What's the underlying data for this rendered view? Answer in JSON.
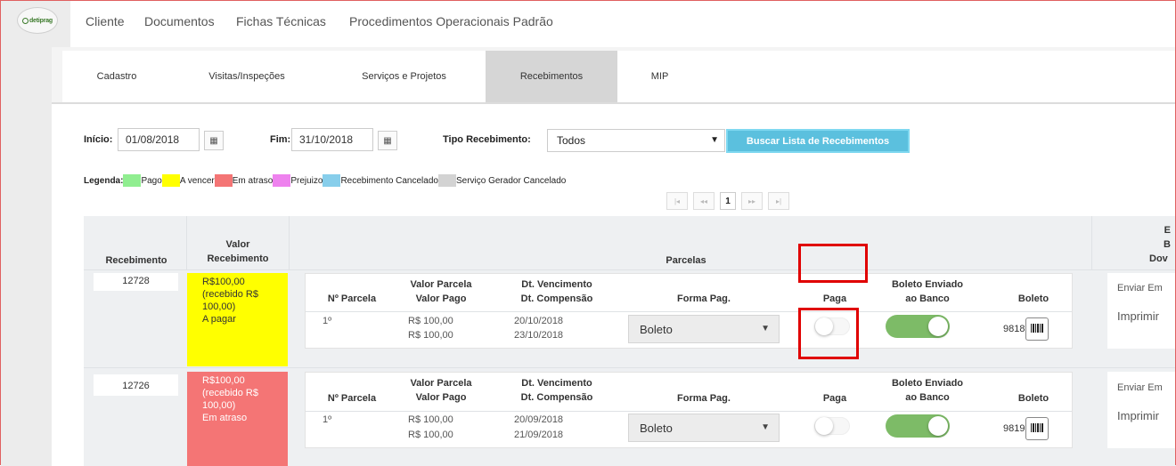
{
  "logo": {
    "text": "detiprag"
  },
  "topnav": {
    "items": [
      "Cliente",
      "Documentos",
      "Fichas Técnicas",
      "Procedimentos Operacionais Padrão"
    ]
  },
  "tabs": [
    {
      "label": "Cadastro",
      "active": false
    },
    {
      "label": "Visitas/Inspeções",
      "active": false
    },
    {
      "label": "Serviços e Projetos",
      "active": false
    },
    {
      "label": "Recebimentos",
      "active": true
    },
    {
      "label": "MIP",
      "active": false
    }
  ],
  "filters": {
    "inicio_label": "Início:",
    "inicio_value": "01/08/2018",
    "fim_label": "Fim:",
    "fim_value": "31/10/2018",
    "tipo_label": "Tipo Recebimento:",
    "tipo_value": "Todos",
    "buscar_label": "Buscar Lista de Recebimentos"
  },
  "legend": {
    "title": "Legenda:",
    "items": [
      {
        "label": "Pago",
        "color": "#90ee90"
      },
      {
        "label": "A vencer",
        "color": "#ffff00"
      },
      {
        "label": "Em atraso",
        "color": "#f47575"
      },
      {
        "label": "Prejuizo",
        "color": "#ee82ee"
      },
      {
        "label": "Recebimento Cancelado",
        "color": "#87ceeb"
      },
      {
        "label": "Serviço Gerador Cancelado",
        "color": "#d3d3d3"
      }
    ]
  },
  "pager": {
    "first": "|◂",
    "prev": "◂◂",
    "current": "1",
    "next": "▸▸",
    "last": "▸|"
  },
  "table": {
    "headers": {
      "recebimento": "Recebimento",
      "valor_line1": "Valor",
      "valor_line2": "Recebimento",
      "parcelas": "Parcelas",
      "extra_line1": "E",
      "extra_line2": "B",
      "extra_line3": "Dov"
    },
    "inner_headers": {
      "parcela": "Nº Parcela",
      "valor_line1": "Valor Parcela",
      "valor_line2": "Valor Pago",
      "dt_line1": "Dt. Vencimento",
      "dt_line2": "Dt. Compensão",
      "forma": "Forma Pag.",
      "paga": "Paga",
      "enviado_line1": "Boleto Enviado",
      "enviado_line2": "ao Banco",
      "boleto": "Boleto"
    },
    "rows": [
      {
        "id": "12728",
        "valor_line1": "R$100,00",
        "valor_line2": "(recebido R$",
        "valor_line3": "100,00)",
        "status": "A pagar",
        "status_color": "#ffff00",
        "parcela": "1º",
        "valor_parcela": "R$ 100,00",
        "valor_pago": "R$ 100,00",
        "dt_vencimento": "20/10/2018",
        "dt_compensacao": "23/10/2018",
        "forma": "Boleto",
        "boleto_num": "9818",
        "enviar": "Enviar Em",
        "imprimir": "Imprimir"
      },
      {
        "id": "12726",
        "valor_line1": "R$100,00",
        "valor_line2": "(recebido R$",
        "valor_line3": "100,00)",
        "status": "Em atraso",
        "status_color": "#f47575",
        "parcela": "1º",
        "valor_parcela": "R$ 100,00",
        "valor_pago": "R$ 100,00",
        "dt_vencimento": "20/09/2018",
        "dt_compensacao": "21/09/2018",
        "forma": "Boleto",
        "boleto_num": "9819",
        "enviar": "Enviar Em",
        "imprimir": "Imprimir"
      }
    ]
  }
}
